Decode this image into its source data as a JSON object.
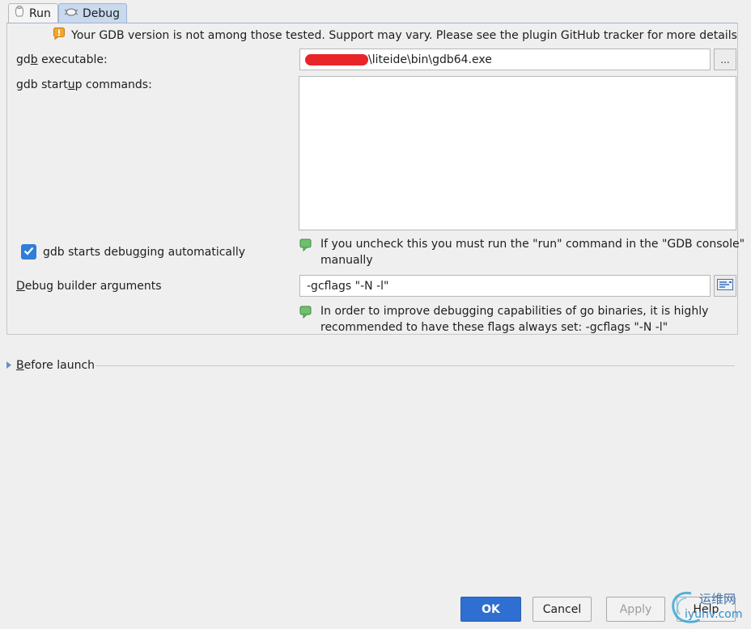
{
  "tabs": [
    {
      "label": "Run"
    },
    {
      "label": "Debug"
    }
  ],
  "warning": {
    "text": "Your GDB version is not among those tested. Support may vary. Please see the plugin GitHub tracker for more details"
  },
  "gdb_executable": {
    "label_pre": "gd",
    "label_u": "b",
    "label_post": " executable:",
    "value": "\\liteide\\bin\\gdb64.exe",
    "browse": "..."
  },
  "startup": {
    "label_pre": "gdb start",
    "label_u": "u",
    "label_post": "p commands:",
    "value": ""
  },
  "auto_start": {
    "label_pre": "gdb starts debu",
    "label_u": "g",
    "label_post": "ging automatically",
    "checked": true,
    "hint": [
      "If you uncheck this you must run the \"run\" command in the \"GDB console\"",
      "manually"
    ]
  },
  "builder": {
    "label_u": "D",
    "label_post": "ebug builder arguments",
    "value": "-gcflags \"-N -l\"",
    "hint": [
      "In order to improve debugging capabilities of go binaries, it is highly",
      "recommended to have these flags always set: -gcflags \"-N -l\""
    ]
  },
  "before_launch": {
    "label_u": "B",
    "label_post": "efore launch"
  },
  "buttons": {
    "ok": "OK",
    "cancel": "Cancel",
    "apply": "Apply",
    "help": "Help"
  },
  "watermark": {
    "line1": "运维网",
    "line2": "iyunv.com"
  },
  "colors": {
    "accent": "#2f6fd2",
    "tab_selected": "#c9d9ee",
    "hint_green": "#5aa85c",
    "warn_orange": "#f2a531"
  }
}
